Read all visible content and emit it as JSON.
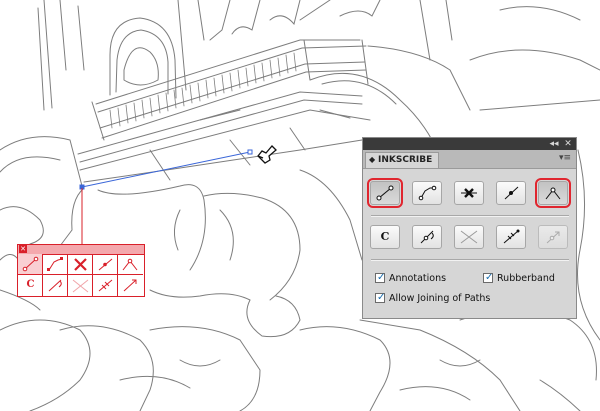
{
  "panel": {
    "title": "INKSCRIBE",
    "titlebar_buttons": {
      "collapse": "◂◂",
      "close": "✕"
    },
    "menu_icon": "▾≡",
    "tools_row1": [
      {
        "name": "line-tool-icon",
        "active": true
      },
      {
        "name": "curve-tool-icon",
        "active": false
      },
      {
        "name": "delete-point-icon",
        "active": false
      },
      {
        "name": "add-point-icon",
        "active": false
      },
      {
        "name": "corner-tool-icon",
        "active": true
      }
    ],
    "tools_row2": [
      {
        "name": "convert-tool-icon",
        "label": "C"
      },
      {
        "name": "smooth-tool-icon"
      },
      {
        "name": "cut-tool-icon"
      },
      {
        "name": "join-tool-icon"
      },
      {
        "name": "reverse-tool-icon",
        "disabled": true
      }
    ],
    "options": {
      "annotations": {
        "label": "Annotations",
        "checked": true
      },
      "rubberband": {
        "label": "Rubberband",
        "checked": true
      },
      "allow_joining": {
        "label": "Allow Joining of Paths",
        "checked": true
      }
    }
  },
  "callout": {
    "close": "✕",
    "row2_label": "C"
  },
  "colors": {
    "accent_red": "#e0262f",
    "path_blue": "#3a66d8",
    "sketch_gray": "#7d7d7d"
  }
}
